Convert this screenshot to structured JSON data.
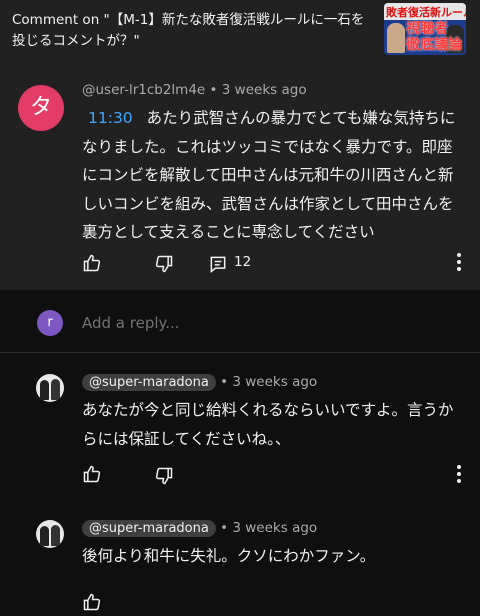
{
  "header": {
    "title": "Comment on \"【M-1】新たな敗者復活戦ルールに一石を投じるコメントが？\"",
    "thumbnail": {
      "top_text": "敗者復活新ルール",
      "main_text_1": "視聴者",
      "main_text_2": "徹底議論"
    }
  },
  "comment": {
    "avatar_letter": "タ",
    "avatar_color": "#e33d67",
    "author": "@user-lr1cb2lm4e",
    "time": "3 weeks ago",
    "timestamp": "11:30",
    "text": "あたり武智さんの暴力でとても嫌な気持ちになりました。これはツッコミではなく暴力です。即座にコンビを解散して田中さんは元和牛の川西さんと新しいコンビを組み、武智さんは作家として田中さんを裏方として支えることに専念してください",
    "reply_count": "12"
  },
  "reply_box": {
    "avatar_letter": "r",
    "avatar_color": "#7e57c2",
    "placeholder": "Add a reply..."
  },
  "replies": [
    {
      "author": "@super-maradona",
      "time": "3 weeks ago",
      "text": "あなたが今と同じ給料くれるならいいですよ。言うからには保証してくださいね。、"
    },
    {
      "author": "@super-maradona",
      "time": "3 weeks ago",
      "text": "後何より和牛に失礼。クソにわかファン。"
    }
  ],
  "colors": {
    "background": "#0f0f0f",
    "panel": "#212121",
    "link": "#3ea6ff"
  }
}
